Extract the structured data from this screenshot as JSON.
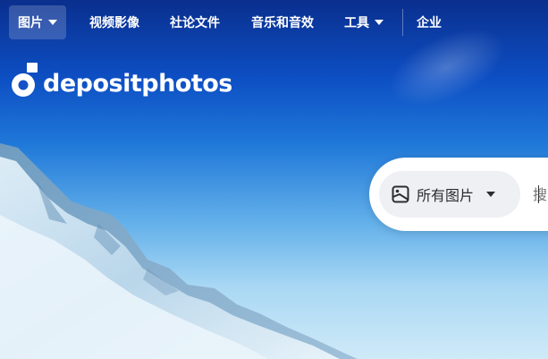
{
  "nav": {
    "items": [
      {
        "label": "图片",
        "has_dropdown": true,
        "active": true
      },
      {
        "label": "视频影像",
        "has_dropdown": false,
        "active": false
      },
      {
        "label": "社论文件",
        "has_dropdown": false,
        "active": false
      },
      {
        "label": "音乐和音效",
        "has_dropdown": false,
        "active": false
      },
      {
        "label": "工具",
        "has_dropdown": true,
        "active": false
      },
      {
        "label": "企业",
        "has_dropdown": false,
        "active": false
      }
    ]
  },
  "logo": {
    "text": "depositphotos"
  },
  "search": {
    "category_label": "所有图片",
    "category_icon": "image-square-icon",
    "input_value": "",
    "input_placeholder": "搜"
  },
  "colors": {
    "nav_text": "#ffffff",
    "search_bg": "#ffffff",
    "category_bg": "#eef0f3",
    "sky_top": "#0a2f8e",
    "sky_bottom": "#cfeaf8"
  }
}
